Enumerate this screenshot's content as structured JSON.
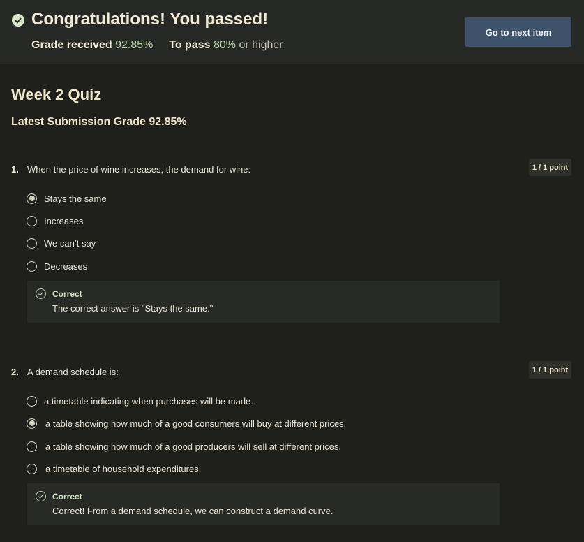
{
  "banner": {
    "title": "Congratulations! You passed!",
    "grade_label": "Grade received",
    "grade_value": "92.85%",
    "pass_label": "To pass",
    "pass_value": "80%",
    "pass_suffix": "or higher",
    "next_button": "Go to next item",
    "icon": "check-circle-icon"
  },
  "quiz": {
    "title": "Week 2 Quiz",
    "latest_grade": "Latest Submission Grade 92.85%"
  },
  "questions": [
    {
      "number": "1.",
      "text": "When the price of wine increases, the demand for wine:",
      "points": "1 / 1 point",
      "options": [
        "Stays the same",
        "Increases",
        "We can’t say",
        "Decreases"
      ],
      "selected_index": 0,
      "feedback_title": "Correct",
      "feedback_text": "The correct answer is \"Stays the same.\""
    },
    {
      "number": "2.",
      "text": "A demand schedule is:",
      "points": "1 / 1 point",
      "options": [
        "a timetable indicating when purchases will be made.",
        "a table showing how much of a good consumers will buy at different prices.",
        "a table showing how much of a good producers will sell at different prices.",
        "a timetable of household expenditures."
      ],
      "selected_index": 1,
      "feedback_title": "Correct",
      "feedback_text": "Correct!  From a demand schedule, we can construct a demand curve."
    }
  ],
  "colors": {
    "background": "#1f1f1c",
    "banner": "#262825",
    "button": "#3f526c",
    "success": "#b9d9a8"
  }
}
